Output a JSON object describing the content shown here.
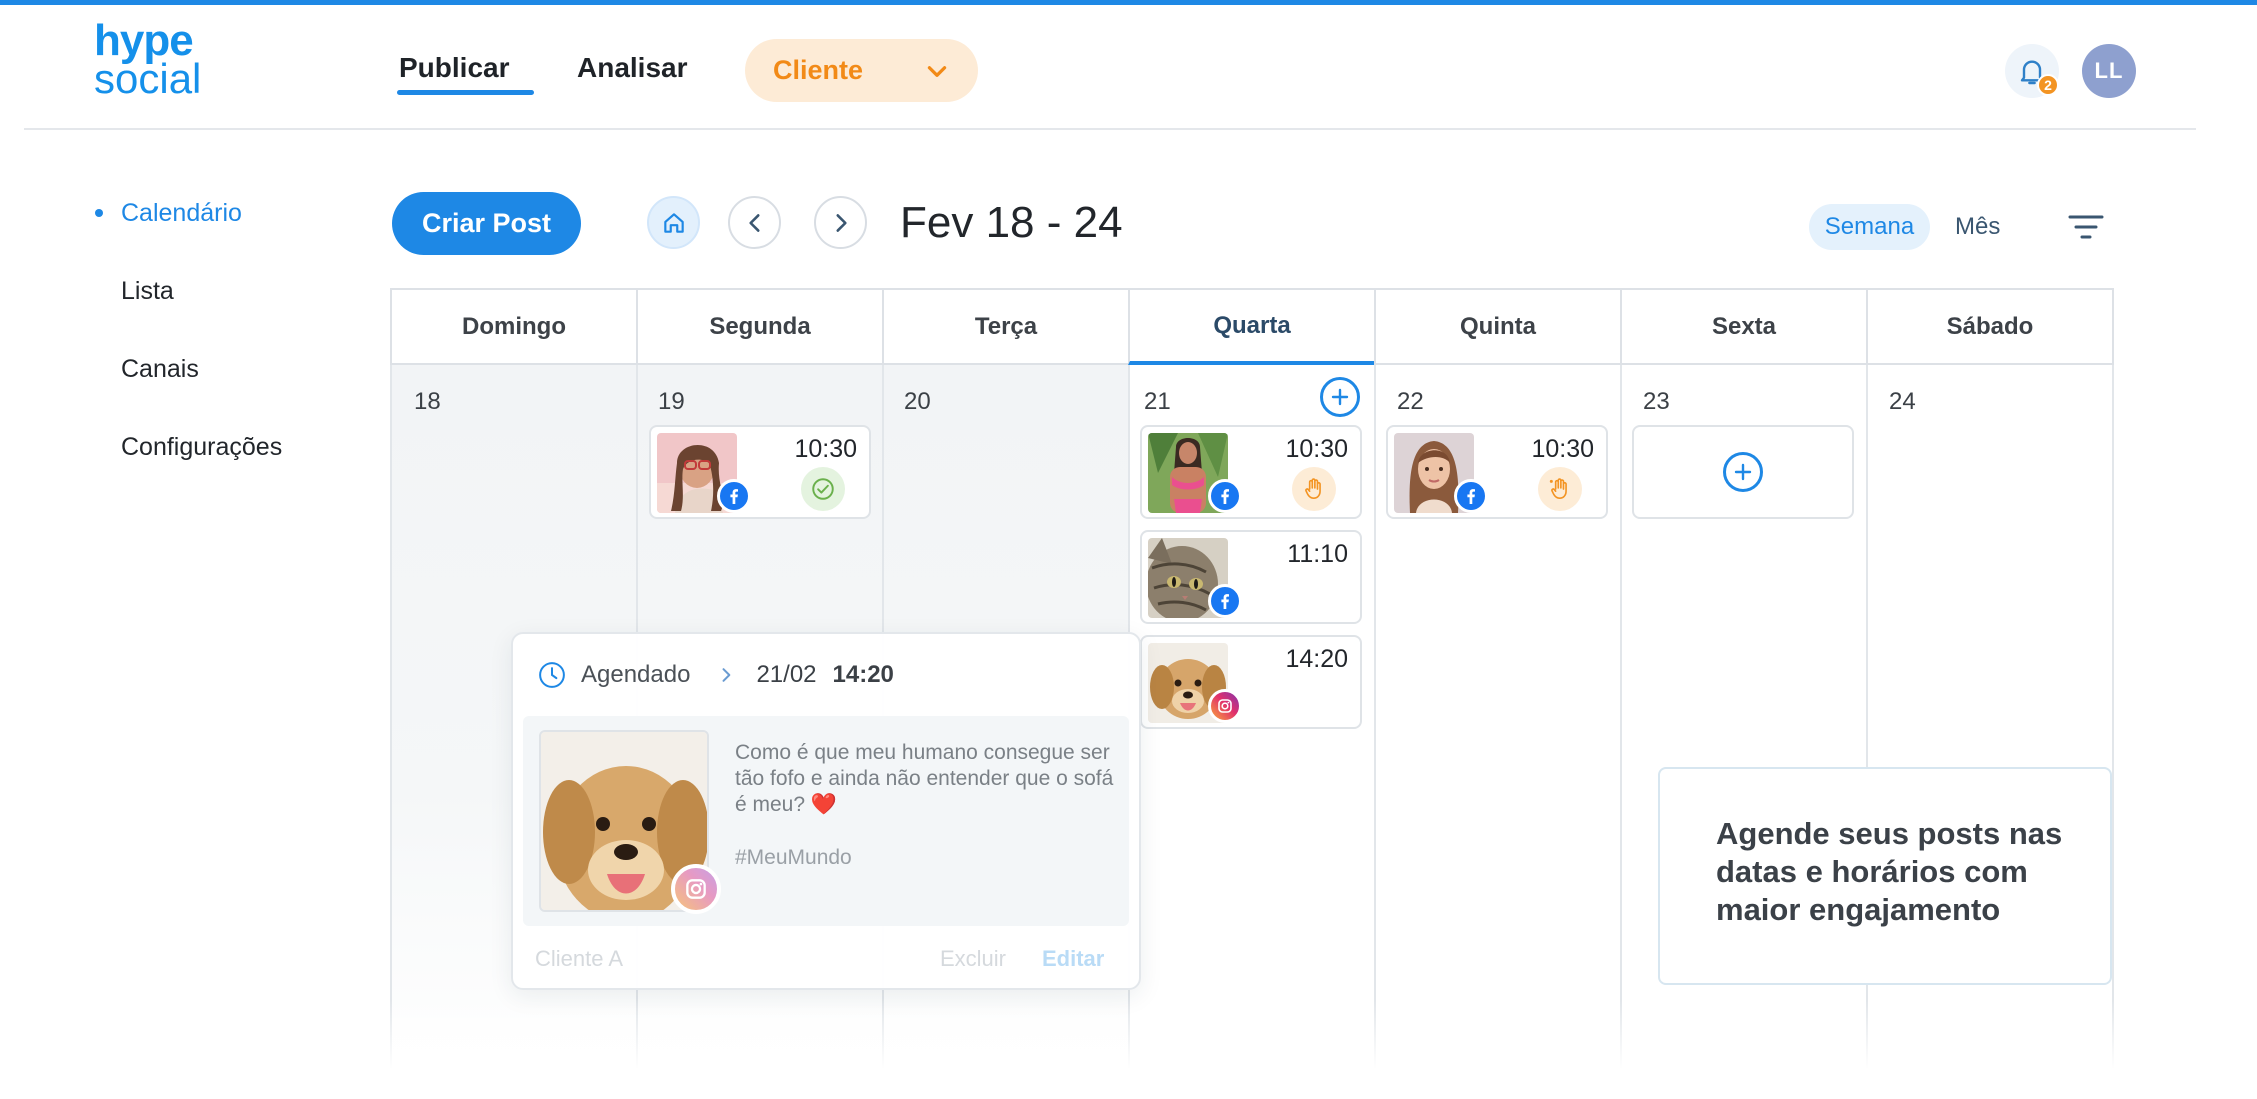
{
  "brand": {
    "logo_line1": "hype",
    "logo_line2": "social",
    "accent": "#1e88e5",
    "warning": "#f39423"
  },
  "nav": {
    "publicar": "Publicar",
    "analisar": "Analisar",
    "client_select": "Cliente",
    "notifications_count": "2",
    "user_initials": "LL"
  },
  "sidebar": [
    {
      "label": "Calendário",
      "active": true
    },
    {
      "label": "Lista"
    },
    {
      "label": "Canais"
    },
    {
      "label": "Configurações"
    }
  ],
  "toolbar": {
    "create_post": "Criar Post",
    "range": "Fev 18 - 24",
    "view_week": "Semana",
    "view_month": "Mês"
  },
  "calendar": {
    "days": [
      {
        "name": "Domingo",
        "date": "18"
      },
      {
        "name": "Segunda",
        "date": "19"
      },
      {
        "name": "Terça",
        "date": "20"
      },
      {
        "name": "Quarta",
        "date": "21"
      },
      {
        "name": "Quinta",
        "date": "22"
      },
      {
        "name": "Sexta",
        "date": "23"
      },
      {
        "name": "Sábado",
        "date": "24"
      }
    ],
    "posts": [
      {
        "day": "Segunda",
        "time": "10:30",
        "network": "facebook",
        "status": "published-check-icon"
      },
      {
        "day": "Quarta",
        "time": "10:30",
        "network": "facebook",
        "status": "pending-hand-icon"
      },
      {
        "day": "Quarta",
        "time": "11:10",
        "network": "facebook"
      },
      {
        "day": "Quarta",
        "time": "14:20",
        "network": "instagram"
      },
      {
        "day": "Quinta",
        "time": "10:30",
        "network": "facebook",
        "status": "pending-hand-icon"
      }
    ]
  },
  "popup": {
    "status": "Agendado",
    "date": "21/02",
    "time": "14:20",
    "caption": "Como é que meu humano consegue ser tão fofo e ainda não entender que o sofá é meu? ❤️",
    "hashtag": "#MeuMundo",
    "client": "Cliente A",
    "delete": "Excluir",
    "edit": "Editar"
  },
  "info": "Agende seus posts nas datas e horários com maior engajamento"
}
